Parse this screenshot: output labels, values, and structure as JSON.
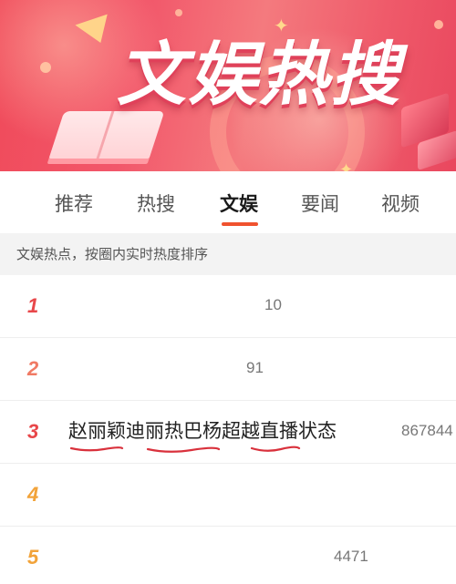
{
  "banner": {
    "title": "文娱热搜"
  },
  "tabs": [
    {
      "label": "推荐",
      "active": false
    },
    {
      "label": "热搜",
      "active": false
    },
    {
      "label": "文娱",
      "active": true
    },
    {
      "label": "要闻",
      "active": false
    },
    {
      "label": "视频",
      "active": false
    }
  ],
  "info": {
    "text": "文娱热点，按圈内实时热度排序"
  },
  "list": [
    {
      "rank": "1",
      "title": "",
      "heat": "10",
      "rank_color": "#e8474a"
    },
    {
      "rank": "2",
      "title": "",
      "heat": "91",
      "rank_color": "#f07a64"
    },
    {
      "rank": "3",
      "title": "赵丽颖迪丽热巴杨超越直播状态",
      "heat": "867844",
      "rank_color": "#e8474a"
    },
    {
      "rank": "4",
      "title": "",
      "heat": "",
      "rank_color": "#f2a33a"
    },
    {
      "rank": "5",
      "title": "",
      "heat": "4471",
      "rank_color": "#f2a33a"
    }
  ],
  "colors": {
    "accent": "#f0522e",
    "banner": "#f04a5a",
    "underline_annotation": "#d9313c"
  }
}
